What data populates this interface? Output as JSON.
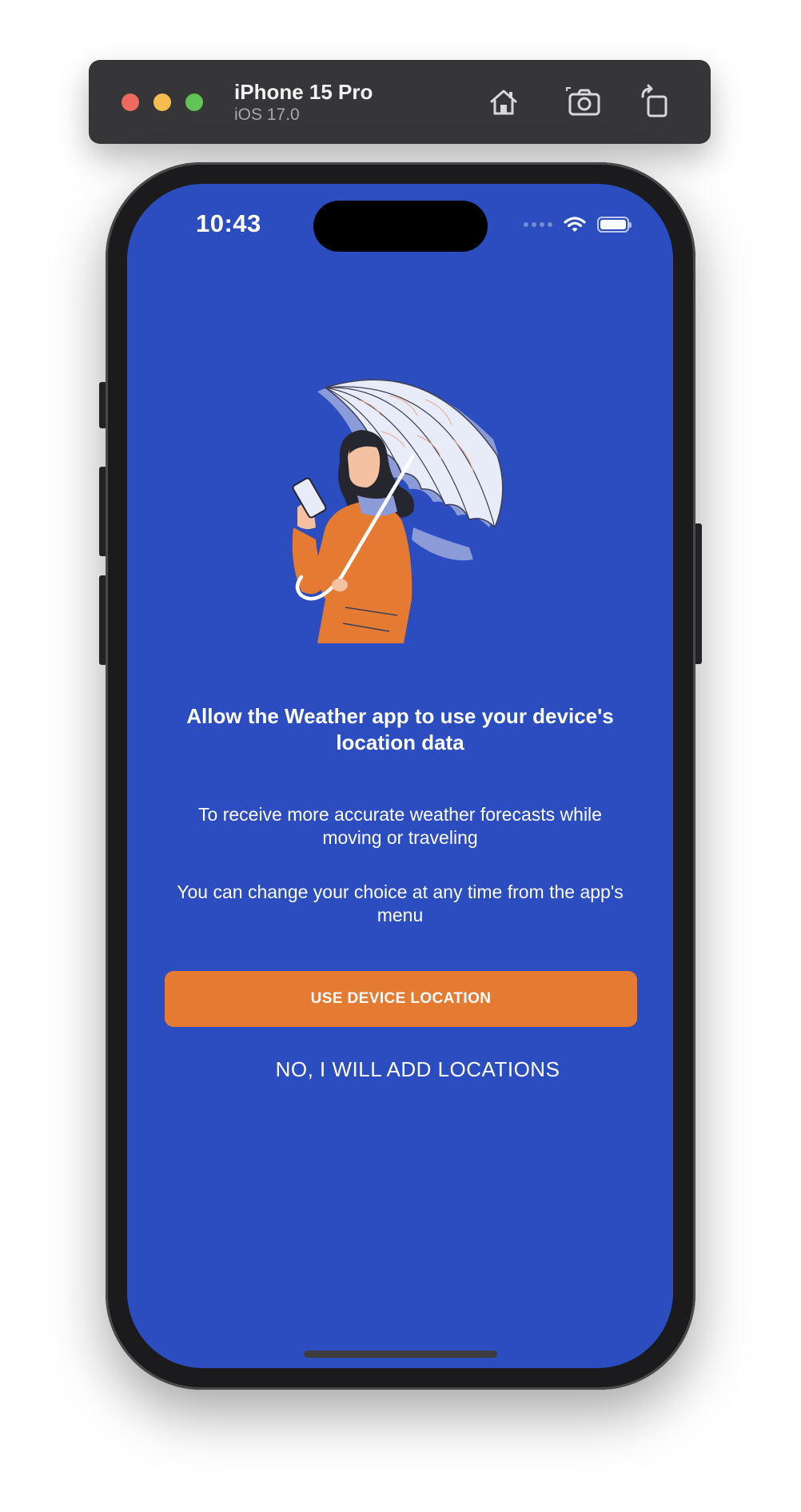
{
  "simulator": {
    "device_name": "iPhone 15 Pro",
    "os_version": "iOS 17.0",
    "buttons": [
      "home-icon",
      "screenshot-icon",
      "rotate-icon"
    ]
  },
  "status_bar": {
    "time": "10:43"
  },
  "onboarding": {
    "title": "Allow the Weather app to use your device's location data",
    "reason": "To receive more accurate weather forecasts while moving or traveling",
    "note": "You can change your choice at any time from the app's menu",
    "primary_button": "USE DEVICE LOCATION",
    "secondary_button": "NO, I WILL ADD LOCATIONS"
  },
  "colors": {
    "screen_background": "#2b4dbf",
    "primary_button": "#e57a33",
    "text": "#ffffff"
  }
}
